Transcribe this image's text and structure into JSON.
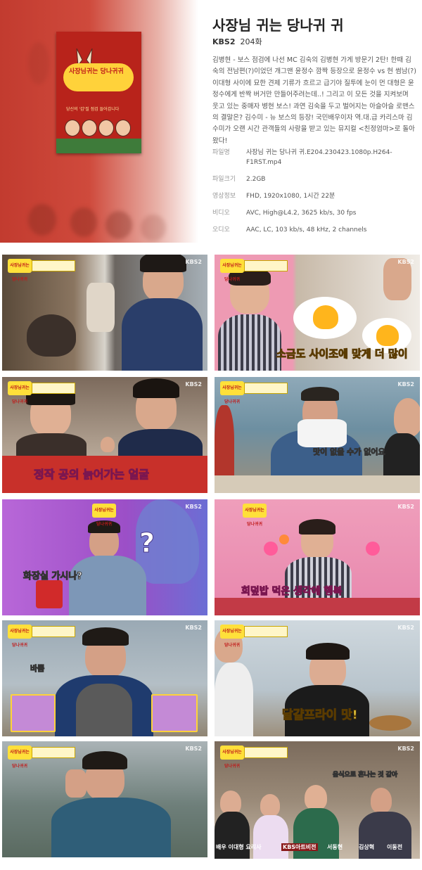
{
  "header": {
    "title": "사장님 귀는 당나귀 귀",
    "channel": "KBS2",
    "episode": "204화",
    "description": "김병현 - 보스 점검에 나선 MC 김숙의 김병현 가게 방문기 2탄! 한때 김숙의 전남편(?)이었던 개그맨 윤정수 깜짝 등장으로 윤정수 vs 현 썸남(?) 이대형 사이에 묘한 견제 기류가 흐르고 급기야 질투에 눈이 먼 대형은 윤정수에게 반짝 버거만 만들어주려는데..! 그리고 이 모든 것을 지켜보며 웃고 있는 중매자 병현 보스! 과연 김숙을 두고 벌어지는 아슬아슬 로맨스의 결말은? 김수미 - 뉴 보스의 등장! 국민배우이자 역.대.급 카리스마   김수미가 오랜 시간 관객들의 사랑을 받고 있는 뮤지컬 <친정엄마>로 돌아왔다!"
  },
  "poster": {
    "logo": "사장님귀는 당나귀귀",
    "subtitle": "당신의 '갑'질 점검 들어갑니다"
  },
  "file_info": [
    {
      "label": "파일명",
      "value": "사장님 귀는 당나귀 귀.E204.230423.1080p.H264-F1RST.mp4"
    },
    {
      "label": "파일크기",
      "value": "2.2GB"
    },
    {
      "label": "영상정보",
      "value": "FHD, 1920x1080, 1시간 22분"
    },
    {
      "label": "비디오",
      "value": "AVC, High@L4.2, 3625 kb/s, 30 fps"
    },
    {
      "label": "오디오",
      "value": "AAC, LC, 103 kb/s, 48 kHz, 2 channels"
    }
  ],
  "thumbnails": [
    {
      "kbs": "KBS2",
      "caption": ""
    },
    {
      "kbs": "KBS2",
      "caption": "소금도 사이조에 맞게 더 많이"
    },
    {
      "kbs": "KBS2",
      "caption": "정작 공의 늙어가는 얼굴"
    },
    {
      "kbs": "KBS2",
      "caption": "맛이 없을 수가 없어요"
    },
    {
      "kbs": "KBS2",
      "caption": "화장실 가시나?"
    },
    {
      "kbs": "KBS2",
      "caption": "회덮밥 먹은 생각에 행복"
    },
    {
      "kbs": "KBS2",
      "caption": "바쁨"
    },
    {
      "kbs": "KBS2",
      "caption": "달걀프라이 맛!"
    },
    {
      "kbs": "KBS2",
      "caption": ""
    },
    {
      "kbs": "KBS2",
      "caption": "음식으로 혼나는 것 같아"
    }
  ],
  "name_tags": [
    "배우 이대형 요리사",
    "KBS아트비전",
    "서동현",
    "김상혁",
    "이동전"
  ],
  "badge_text": "사장님귀는 당나귀귀"
}
